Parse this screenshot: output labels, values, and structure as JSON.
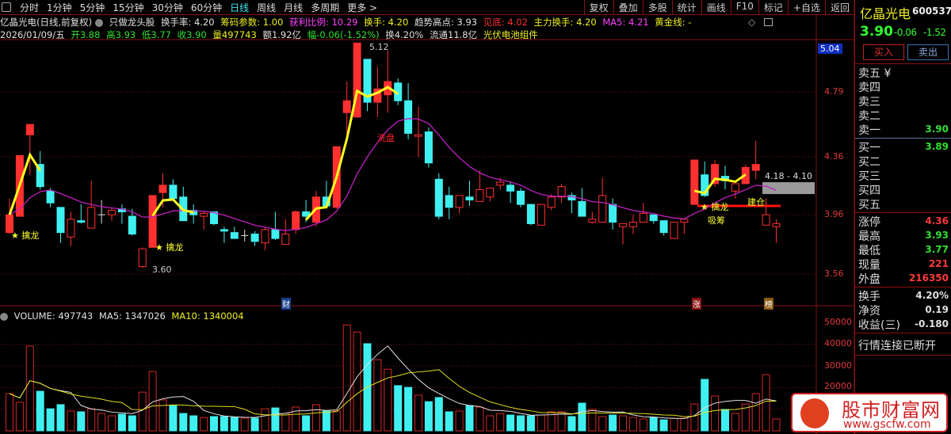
{
  "toolbar": {
    "periods": [
      "分时",
      "1分钟",
      "5分钟",
      "15分钟",
      "30分钟",
      "60分钟",
      "日线",
      "周线",
      "月线",
      "多周期",
      "更多 >"
    ],
    "active": "日线",
    "actions": [
      "复权",
      "叠加",
      "多股",
      "统计",
      "画线",
      "F10",
      "标记",
      "+自选",
      "返回"
    ]
  },
  "info1": {
    "name": "亿晶光电(日线,前复权)",
    "strategy": "只做龙头股",
    "turnover_rate": "换手率: 4.20",
    "chip": "筹码参数: 1.00",
    "profit_ratio": "获利比例: 10.29",
    "turnover": "换手: 4.20",
    "trend_high": "趋势高点: 3.93",
    "bottom": "见底: 4.02",
    "main_turnover": "主力换手: 4.20",
    "ma5": "MA5: 4.21",
    "golden": "黄金线: -"
  },
  "info2": {
    "date": "2026/01/09/五",
    "open": "开3.88",
    "high": "高3.93",
    "low": "低3.77",
    "close": "收3.90",
    "vol": "量497743",
    "amount": "额1.92亿",
    "range": "幅-0.06(-1.52%)",
    "turn": "换4.20%",
    "float": "流通11.8亿",
    "sector": "光伏电池组件"
  },
  "volume_header": {
    "vol": "VOLUME: 497743",
    "ma5": "MA5: 1347026",
    "ma10": "MA10: 1340004"
  },
  "price_axis": [
    "5.04",
    "4.79",
    "4.36",
    "3.96",
    "3.56"
  ],
  "volume_axis": [
    "50000",
    "40000",
    "30000",
    "20000"
  ],
  "annotations": {
    "high": "5.12",
    "low": "3.60",
    "wash": "洗盘",
    "dragon": "擒龙",
    "absorb": "吸筹",
    "build": "建仓",
    "range": "4.18 - 4.10",
    "tag_cai": "财",
    "tag_zhang": "涨",
    "tag_bang": "榜"
  },
  "quote": {
    "name": "亿晶光电",
    "code": "600537",
    "price": "3.90",
    "change": "-0.06",
    "pct": "-1.52",
    "buy": "买入",
    "sell": "卖出",
    "asks": [
      {
        "l": "卖五 ¥",
        "v": ""
      },
      {
        "l": "卖四",
        "v": ""
      },
      {
        "l": "卖三",
        "v": ""
      },
      {
        "l": "卖二",
        "v": ""
      },
      {
        "l": "卖一",
        "v": "3.90"
      }
    ],
    "bids": [
      {
        "l": "买一",
        "v": "3.89"
      },
      {
        "l": "买二",
        "v": ""
      },
      {
        "l": "买三",
        "v": ""
      },
      {
        "l": "买四",
        "v": ""
      },
      {
        "l": "买五",
        "v": ""
      }
    ],
    "stats": [
      {
        "l": "涨停",
        "v": "4.36",
        "c": "#ff3a3a"
      },
      {
        "l": "最高",
        "v": "3.93",
        "c": "#30e030"
      },
      {
        "l": "最低",
        "v": "3.77",
        "c": "#30e030"
      },
      {
        "l": "现量",
        "v": "221",
        "c": "#ff3a3a"
      },
      {
        "l": "外盘",
        "v": "216350",
        "c": "#ff3a3a"
      }
    ],
    "fin": [
      {
        "l": "换手",
        "v": "4.20%"
      },
      {
        "l": "净资",
        "v": "0.19"
      },
      {
        "l": "收益(三)",
        "v": "-0.180"
      }
    ],
    "status": "行情连接已断开"
  },
  "watermark": {
    "text": "股市财富网",
    "url": "www.gscfw.com"
  },
  "colors": {
    "up": "#ff3030",
    "down": "#40f0f0",
    "ma": "#c020c0",
    "fast": "#ffff20",
    "vol_ma5": "#e0e0e0",
    "vol_ma10": "#e0e020"
  },
  "chart_data": {
    "type": "candlestick",
    "ylim": [
      3.56,
      5.12
    ],
    "candles": [
      [
        3.84,
        4.07,
        3.83,
        3.96,
        1
      ],
      [
        3.95,
        4.36,
        3.95,
        4.36,
        1
      ],
      [
        4.5,
        4.57,
        4.23,
        4.57,
        1
      ],
      [
        4.3,
        4.39,
        4.13,
        4.15,
        0
      ],
      [
        4.12,
        4.14,
        4.01,
        4.04,
        0
      ],
      [
        4.01,
        4.01,
        3.77,
        3.84,
        0
      ],
      [
        3.81,
        3.98,
        3.75,
        3.93,
        0
      ],
      [
        3.92,
        4.03,
        3.9,
        3.91,
        0
      ],
      [
        3.87,
        4.19,
        3.87,
        4.01,
        0
      ],
      [
        3.96,
        4.06,
        3.9,
        3.96,
        0
      ],
      [
        3.96,
        4.01,
        3.92,
        3.99,
        0
      ],
      [
        4.0,
        4.03,
        3.9,
        3.98,
        0
      ],
      [
        3.95,
        4.0,
        3.82,
        3.83,
        0
      ],
      [
        3.61,
        3.74,
        3.6,
        3.73,
        0
      ],
      [
        3.74,
        4.09,
        3.74,
        4.09,
        1
      ],
      [
        4.11,
        4.24,
        4.01,
        4.16,
        1
      ],
      [
        4.16,
        4.2,
        4.06,
        4.07,
        0
      ],
      [
        4.08,
        4.15,
        3.92,
        3.92,
        0
      ],
      [
        3.99,
        4.03,
        3.9,
        3.96,
        0
      ],
      [
        3.95,
        3.98,
        3.86,
        3.97,
        0
      ],
      [
        3.98,
        3.98,
        3.89,
        3.9,
        0
      ],
      [
        3.86,
        3.88,
        3.77,
        3.85,
        0
      ],
      [
        3.84,
        3.88,
        3.8,
        3.8,
        0
      ],
      [
        3.82,
        3.86,
        3.78,
        3.82,
        0
      ],
      [
        3.83,
        3.85,
        3.75,
        3.78,
        0
      ],
      [
        3.77,
        3.88,
        3.72,
        3.86,
        0
      ],
      [
        3.86,
        3.98,
        3.79,
        3.8,
        0
      ],
      [
        3.76,
        3.93,
        3.76,
        3.83,
        0
      ],
      [
        3.86,
        3.99,
        3.83,
        3.98,
        1
      ],
      [
        3.98,
        4.06,
        3.91,
        3.95,
        0
      ],
      [
        3.91,
        4.12,
        3.88,
        4.08,
        1
      ],
      [
        4.08,
        4.19,
        4.01,
        4.02,
        0
      ],
      [
        4.01,
        4.42,
        4.0,
        4.42,
        1
      ],
      [
        4.65,
        4.86,
        4.48,
        4.73,
        1
      ],
      [
        4.62,
        5.12,
        4.62,
        5.12,
        1
      ],
      [
        5.01,
        5.01,
        4.66,
        4.72,
        0
      ],
      [
        4.72,
        4.96,
        4.62,
        4.81,
        1
      ],
      [
        4.77,
        5.07,
        4.65,
        4.86,
        1
      ],
      [
        4.85,
        4.88,
        4.7,
        4.73,
        0
      ],
      [
        4.73,
        4.85,
        4.47,
        4.51,
        0
      ],
      [
        4.49,
        4.69,
        4.35,
        4.5,
        0
      ],
      [
        4.52,
        4.55,
        4.28,
        4.31,
        0
      ],
      [
        4.2,
        4.24,
        3.93,
        3.95,
        0
      ],
      [
        4.09,
        4.15,
        3.93,
        4.01,
        0
      ],
      [
        4.01,
        4.09,
        3.97,
        4.09,
        0
      ],
      [
        4.08,
        4.19,
        4.02,
        4.06,
        0
      ],
      [
        4.05,
        4.26,
        4.05,
        4.13,
        0
      ],
      [
        4.08,
        4.14,
        4.05,
        4.14,
        0
      ],
      [
        4.16,
        4.21,
        4.13,
        4.18,
        0
      ],
      [
        4.16,
        4.18,
        4.04,
        4.12,
        0
      ],
      [
        4.12,
        4.14,
        4.01,
        4.03,
        0
      ],
      [
        4.03,
        4.03,
        3.89,
        3.9,
        0
      ],
      [
        3.89,
        4.03,
        3.89,
        4.03,
        0
      ],
      [
        4.01,
        4.1,
        3.99,
        4.08,
        0
      ],
      [
        4.08,
        4.17,
        4.04,
        4.15,
        0
      ],
      [
        4.09,
        4.11,
        3.97,
        4.06,
        0
      ],
      [
        4.05,
        4.14,
        3.95,
        3.95,
        0
      ],
      [
        3.91,
        3.98,
        3.9,
        3.93,
        0
      ],
      [
        3.91,
        4.21,
        3.91,
        4.09,
        0
      ],
      [
        4.03,
        4.07,
        3.86,
        3.91,
        0
      ],
      [
        3.88,
        3.9,
        3.76,
        3.9,
        0
      ],
      [
        3.88,
        3.96,
        3.83,
        3.91,
        0
      ],
      [
        3.91,
        4.04,
        3.91,
        3.97,
        0
      ],
      [
        3.96,
        3.96,
        3.9,
        3.92,
        0
      ],
      [
        3.92,
        3.92,
        3.82,
        3.84,
        0
      ],
      [
        3.8,
        3.91,
        3.8,
        3.91,
        0
      ],
      [
        3.91,
        3.93,
        3.83,
        3.93,
        0
      ],
      [
        4.03,
        4.33,
        4.03,
        4.33,
        1
      ],
      [
        4.23,
        4.32,
        4.08,
        4.09,
        0
      ],
      [
        4.17,
        4.33,
        4.15,
        4.3,
        1
      ],
      [
        4.22,
        4.29,
        4.13,
        4.19,
        0
      ],
      [
        4.12,
        4.17,
        4.07,
        4.17,
        0
      ],
      [
        4.17,
        4.3,
        4.17,
        4.28,
        1
      ],
      [
        4.26,
        4.46,
        4.2,
        4.3,
        1
      ],
      [
        3.89,
        4.07,
        3.89,
        3.96,
        0
      ],
      [
        3.88,
        3.93,
        3.77,
        3.9,
        0
      ]
    ],
    "volume": [
      17200,
      13200,
      39200,
      18300,
      10200,
      12100,
      9150,
      8800,
      10200,
      8050,
      6950,
      7700,
      6950,
      17900,
      27400,
      14300,
      11700,
      8050,
      6950,
      6200,
      6600,
      6600,
      6200,
      5850,
      5850,
      10200,
      10600,
      8050,
      11000,
      6950,
      12100,
      9150,
      9150,
      49000,
      45700,
      40300,
      32900,
      28500,
      20900,
      20100,
      16500,
      13500,
      15400,
      8800,
      9150,
      11700,
      11000,
      6950,
      8050,
      7300,
      6950,
      6950,
      7300,
      8800,
      8800,
      6600,
      12800,
      9900,
      6600,
      7300,
      6950,
      6200,
      5500,
      6200,
      5100,
      5850,
      5850,
      12400,
      23800,
      16100,
      9900,
      8050,
      12400,
      17200,
      26000,
      5500
    ],
    "volume_ylim": [
      0,
      50000
    ],
    "fast_line_ranges": [
      [
        0,
        3
      ],
      [
        14,
        18
      ],
      [
        29,
        38
      ],
      [
        67,
        72
      ]
    ]
  }
}
